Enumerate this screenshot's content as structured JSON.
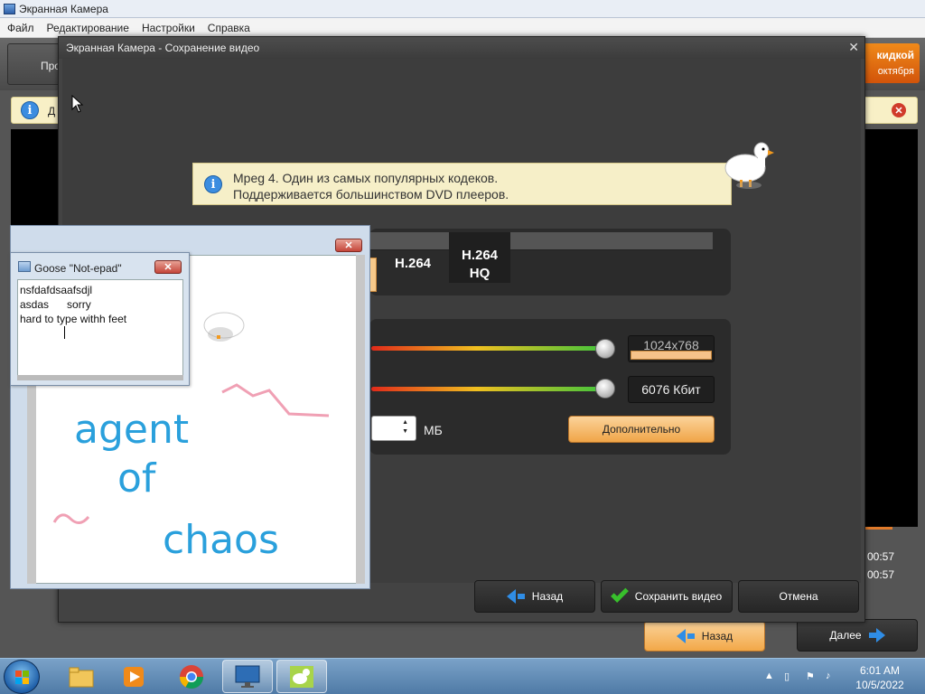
{
  "app": {
    "title": "Экранная Камера",
    "menu": [
      "Файл",
      "Редактирование",
      "Настройки",
      "Справка"
    ],
    "tab_label": "Про",
    "promo_line1": "кидкой",
    "promo_line2": "октября",
    "info_text": "Д",
    "time1": "00:57",
    "time2": "00:57",
    "back_label": "Назад",
    "next_label": "Далее"
  },
  "dialog": {
    "title": "Экранная Камера - Сохранение видео",
    "codec_info_line1": "Mpeg 4. Один из самых популярных кодеков.",
    "codec_info_line2": "Поддерживается большинством DVD плееров.",
    "codec_options": [
      "H.264",
      "H.264 HQ"
    ],
    "codec_hq_line1": "H.264",
    "codec_hq_line2": "HQ",
    "resolution_value": "1024x768",
    "bitrate_value": "6076 Кбит",
    "size_unit": "МБ",
    "advanced_label": "Дополнительно",
    "buttons": {
      "back": "Назад",
      "save": "Сохранить видео",
      "cancel": "Отмена"
    }
  },
  "goose_notepad": {
    "title": "Goose \"Not-epad\"",
    "lines": [
      "nsfdafdsaafsdjl",
      "asdas      sorry",
      "hard to type withh feet"
    ]
  },
  "drawing": {
    "words": [
      "agent",
      "of",
      "chaos"
    ]
  },
  "taskbar": {
    "time": "6:01 AM",
    "date": "10/5/2022"
  },
  "colors": {
    "accent_orange": "#f2a848",
    "dialog_bg": "#434343",
    "info_bg": "#f6efc8",
    "scribble_blue": "#2aa0dc",
    "scribble_pink": "#f0a0b4"
  }
}
